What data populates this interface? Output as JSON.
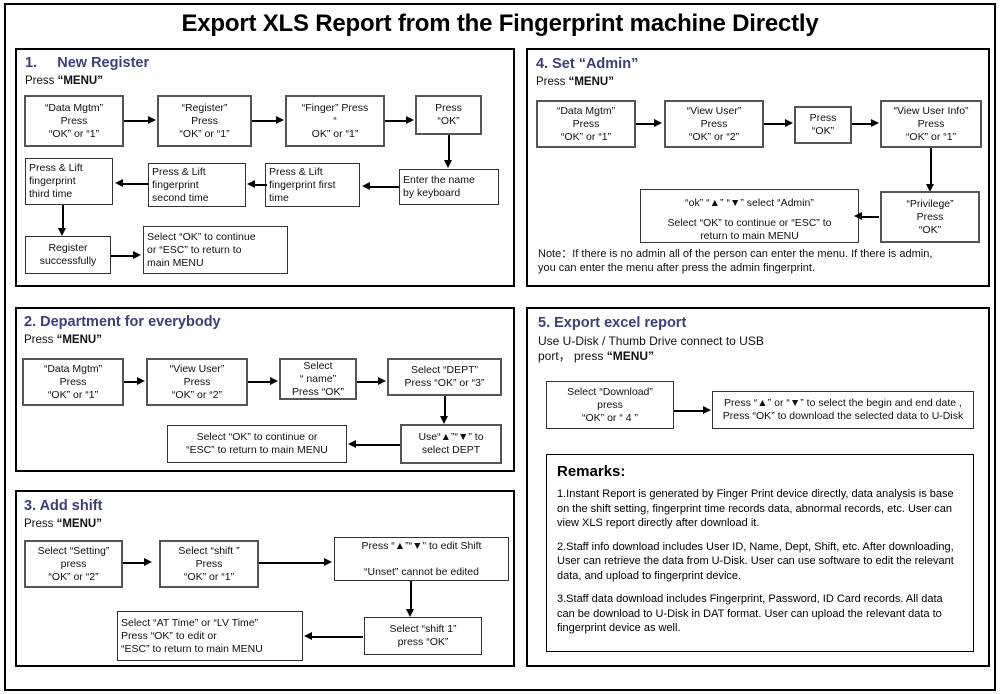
{
  "title": "Export XLS Report from the Fingerprint machine Directly",
  "sections": {
    "new_register": {
      "heading": "1.     New Register",
      "sub_prefix": "Press ",
      "sub_bold": "“MENU”",
      "boxes": {
        "data_mgtm": "“Data Mgtm”\nPress\n“OK” or “1”",
        "register": "“Register”\nPress\n“OK” or “1”",
        "finger": "“Finger” Press\n“\nOK” or “1”",
        "press_ok": "Press\n“OK”",
        "enter_name": "Enter the name\nby keyboard",
        "lift_first": "Press & Lift\nfingerprint first\ntime",
        "lift_second": "Press & Lift\nfingerprint\nsecond time",
        "lift_third": "Press & Lift\nfingerprint\nthird time",
        "register_success": "Register\nsuccessfully",
        "select_ok": "Select “OK” to  continue\nor “ESC” to return to\nmain MENU"
      }
    },
    "department": {
      "heading": "2. Department for everybody",
      "sub_prefix": "Press ",
      "sub_bold": "“MENU”",
      "boxes": {
        "data_mgtm": "“Data Mgtm”\nPress\n“OK” or “1”",
        "view_user": "“View User”\nPress\n“OK” or “2”",
        "select_name": "Select\n“ name”\nPress “OK”",
        "select_dept": "Select “DEPT”\nPress “OK” or “3”",
        "use_arrows": "Use“▲”“▼” to\nselect DEPT",
        "select_ok": "Select “OK” to  continue or\n“ESC” to return to main MENU"
      }
    },
    "add_shift": {
      "heading": "3. Add shift",
      "sub_prefix": "Press ",
      "sub_bold": "“MENU”",
      "boxes": {
        "select_setting": "Select “Setting”\npress\n“OK” or “2”",
        "select_shift": "Select “shift ”\nPress\n“OK” or “1”",
        "edit_shift": "Press “▲”“▼” to edit Shift\n\n“Unset” cannot be edited",
        "select_shift1": "Select “shift 1”\npress “OK”",
        "select_time": "Select “AT Time” or “LV Time”\nPress “OK” to  edit or\n“ESC” to return to main MENU"
      }
    },
    "set_admin": {
      "heading": "4. Set “Admin”",
      "sub_prefix": "Press ",
      "sub_bold": "“MENU”",
      "boxes": {
        "data_mgtm": "“Data Mgtm”\nPress\n“OK” or “1”",
        "view_user": "“View User”\nPress\n“OK” or “2”",
        "press_ok": "Press\n“OK”",
        "view_user_info": "“View User Info”\nPress\n“OK” or “1”",
        "privilege": "“Privilege”\nPress\n“OK”",
        "select_admin_line1": "“ok” “▲” “▼” select “Admin”",
        "select_admin_line2": "Select “OK” to  continue or “ESC” to\nreturn to main MENU"
      },
      "note": "Note：If there is no admin all of the person can enter the menu. If there is admin,\nyou can enter the menu after press the admin fingerprint."
    },
    "export_report": {
      "heading": "5. Export excel report",
      "sub_line1": "Use U-Disk / Thumb Drive connect to USB",
      "sub_line2_prefix": "port， press ",
      "sub_line2_bold": "“MENU”",
      "boxes": {
        "select_download": "Select “Download”\npress\n“OK” or “ 4 ”",
        "press_arrows": "Press “▲” or “▼” to select the begin and end date ,\nPress “OK” to download the selected data to U-Disk"
      },
      "remarks": {
        "title": "Remarks:",
        "items": [
          "1.Instant Report is generated by Finger Print device directly, data analysis is base on the shift setting, fingerprint time records data, abnormal records, etc. User can view XLS report directly after download it.",
          "2.Staff info download includes User ID, Name, Dept, Shift, etc. After downloading, User can retrieve the data from U-Disk. User can use software to edit the relevant data, and upload to fingerprint device.",
          "3.Staff data download includes Fingerprint, Password, ID Card records. All data can be download to U-Disk in DAT format. User can upload the relevant data to fingerprint device as well."
        ]
      }
    }
  },
  "colors": {
    "heading": "#3b3f7a",
    "border": "#000000",
    "background": "#ffffff"
  }
}
